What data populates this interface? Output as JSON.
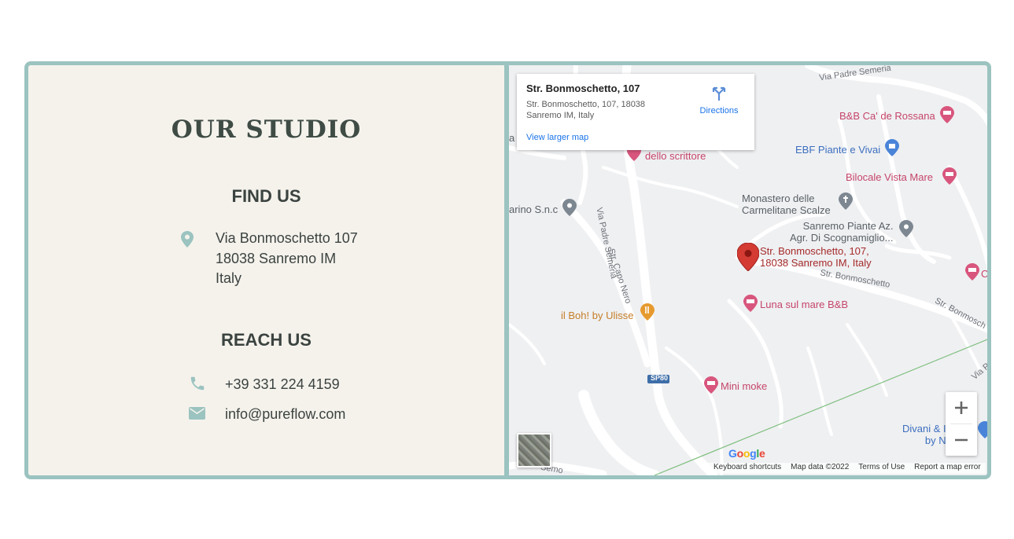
{
  "studio": {
    "title": "OUR STUDIO",
    "find_title": "FIND US",
    "address": [
      "Via Bonmoschetto 107",
      "18038 Sanremo IM",
      "Italy"
    ],
    "reach_title": "REACH US",
    "phone": "+39 331 224 4159",
    "email": "info@pureflow.com"
  },
  "map": {
    "infocard": {
      "title": "Str. Bonmoschetto, 107",
      "address_line1": "Str. Bonmoschetto, 107, 18038",
      "address_line2": "Sanremo IM, Italy",
      "view_larger": "View larger map",
      "directions": "Directions"
    },
    "marker_label_1": "Str. Bonmoschetto, 107,",
    "marker_label_2": "18038 Sanremo IM, Italy",
    "places": {
      "bb_ca_de_rossana": "B&B Ca' de Rossana",
      "ebf": "EBF Piante e Vivai",
      "bilocale": "Bilocale Vista Mare",
      "monastero_1": "Monastero delle",
      "monastero_2": "Carmelitane Scalze",
      "sanremo_piante_1": "Sanremo Piante Az.",
      "sanremo_piante_2": "Agr. Di Scognamiglio...",
      "dello_scrittore": "dello scrittore",
      "marino": "arino S.n.c",
      "luna": "Luna sul mare B&B",
      "il_boh": "il Boh! by Ulisse",
      "mini_moke": "Mini moke",
      "divani_1": "Divani & I",
      "divani_2": "by N",
      "co": "Co",
      "a_n": "a N"
    },
    "roads": {
      "via_padre_semeria_top": "Via Padre Semeria",
      "via_padre_semeria": "Via Padre Semeria",
      "str_capo_nero": "Str. Capo Nero",
      "str_bonmoschetto": "Str. Bonmoschetto",
      "str_bonmosch": "Str. Bonmosch",
      "via_pa": "Via Pa",
      "sp80": "SP80",
      "semo": "Semo"
    },
    "google": "Google",
    "footer": {
      "shortcuts": "Keyboard shortcuts",
      "map_data": "Map data ©2022",
      "terms": "Terms of Use",
      "report": "Report a map error"
    },
    "colors": {
      "poi_pink": "#c5456a",
      "poi_blue": "#3c6fbf",
      "marker_red": "#b92b27",
      "accent_teal": "#9bc3c0"
    }
  }
}
